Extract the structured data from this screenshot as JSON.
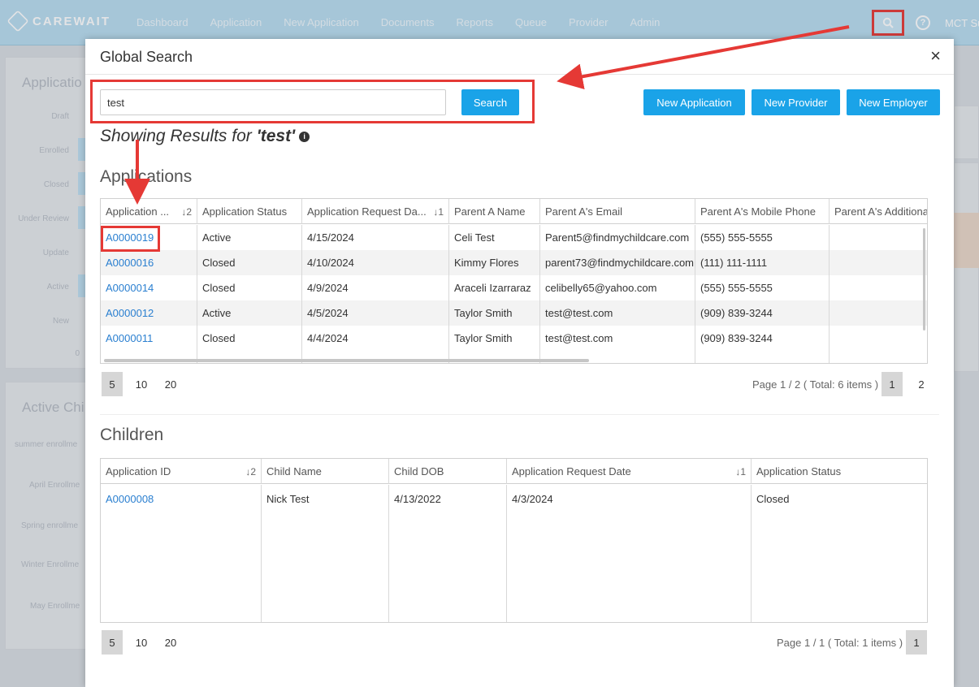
{
  "nav": {
    "brand": "CAREWAIT",
    "items": [
      "Dashboard",
      "Application",
      "New Application",
      "Documents",
      "Reports",
      "Queue",
      "Provider",
      "Admin"
    ],
    "user": "MCT Su"
  },
  "background": {
    "panel1_title": "Applicatio",
    "panel1_labels": [
      "Draft",
      "Enrolled",
      "Closed",
      "Under Review",
      "Update",
      "Active",
      "New"
    ],
    "panel1_zero": "0",
    "panel2_title": "Active Chi",
    "panel2_labels": [
      "summer enrollme",
      "April Enrollme",
      "Spring enrollme",
      "Winter Enrollme",
      "May Enrollme"
    ]
  },
  "modal": {
    "title": "Global Search",
    "close": "×",
    "search_value": "test",
    "search_button": "Search",
    "buttons": [
      "New Application",
      "New Provider",
      "New Employer"
    ],
    "results_prefix": "Showing Results for",
    "results_query": "'test'",
    "info": "i"
  },
  "applications": {
    "title": "Applications",
    "columns": [
      {
        "label": "Application ...",
        "sort": "↓2"
      },
      {
        "label": "Application Status",
        "sort": ""
      },
      {
        "label": "Application Request Da...",
        "sort": "↓1"
      },
      {
        "label": "Parent A Name",
        "sort": ""
      },
      {
        "label": "Parent A's Email",
        "sort": ""
      },
      {
        "label": "Parent A's Mobile Phone",
        "sort": ""
      },
      {
        "label": "Parent A's Additiona",
        "sort": ""
      }
    ],
    "rows": [
      [
        "A0000019",
        "Active",
        "4/15/2024",
        "Celi Test",
        "Parent5@findmychildcare.com",
        "(555) 555-5555",
        ""
      ],
      [
        "A0000016",
        "Closed",
        "4/10/2024",
        "Kimmy Flores",
        "parent73@findmychildcare.com",
        "(111) 111-1111",
        ""
      ],
      [
        "A0000014",
        "Closed",
        "4/9/2024",
        "Araceli Izarraraz",
        "celibelly65@yahoo.com",
        "(555) 555-5555",
        ""
      ],
      [
        "A0000012",
        "Active",
        "4/5/2024",
        "Taylor Smith",
        "test@test.com",
        "(909) 839-3244",
        ""
      ],
      [
        "A0000011",
        "Closed",
        "4/4/2024",
        "Taylor Smith",
        "test@test.com",
        "(909) 839-3244",
        ""
      ]
    ],
    "page_sizes": [
      "5",
      "10",
      "20"
    ],
    "pager_info": "Page 1 / 2 ( Total: 6 items )",
    "pages": [
      "1",
      "2"
    ]
  },
  "children": {
    "title": "Children",
    "columns": [
      {
        "label": "Application ID",
        "sort": "↓2"
      },
      {
        "label": "Child Name",
        "sort": ""
      },
      {
        "label": "Child DOB",
        "sort": ""
      },
      {
        "label": "Application Request Date",
        "sort": "↓1"
      },
      {
        "label": "Application Status",
        "sort": ""
      }
    ],
    "rows": [
      [
        "A0000008",
        "Nick Test",
        "4/13/2022",
        "4/3/2024",
        "Closed"
      ]
    ],
    "page_sizes": [
      "5",
      "10",
      "20"
    ],
    "pager_info": "Page 1 / 1 ( Total: 1 items )",
    "pages": [
      "1"
    ]
  },
  "colors": {
    "primary_button": "#1aa3e8",
    "link": "#2a7fd0",
    "annotation": "#e53935",
    "nav_bg": "#b9ddf0"
  }
}
